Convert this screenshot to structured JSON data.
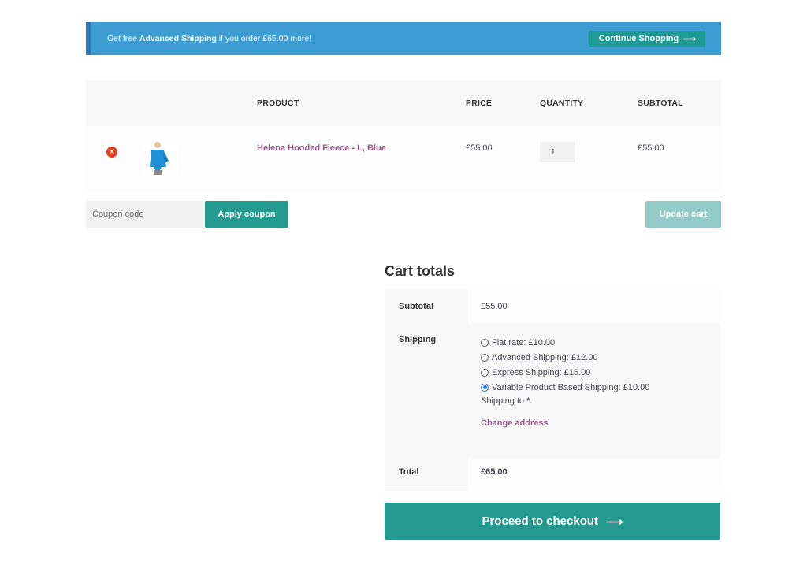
{
  "notice": {
    "prefix": "Get free ",
    "highlight": "Advanced Shipping",
    "suffix": " if you order £65.00 more!",
    "button_label": "Continue Shopping",
    "button_icon": "arrow-right-icon"
  },
  "cart": {
    "columns": [
      "",
      "",
      "PRODUCT",
      "PRICE",
      "QUANTITY",
      "SUBTOTAL"
    ],
    "items": [
      {
        "remove_icon": "remove-x-icon",
        "image": "blue-hooded-fleece",
        "name": "Helena Hooded Fleece - L, Blue",
        "price": "£55.00",
        "quantity": "1",
        "subtotal": "£55.00"
      }
    ]
  },
  "actions": {
    "coupon_placeholder": "Coupon code",
    "apply_coupon": "Apply coupon",
    "update_cart": "Update cart"
  },
  "totals": {
    "title": "Cart totals",
    "subtotal_label": "Subtotal",
    "subtotal_value": "£55.00",
    "shipping_label": "Shipping",
    "shipping_options": [
      {
        "label": "Flat rate: £10.00",
        "selected": false
      },
      {
        "label": "Advanced Shipping: £12.00",
        "selected": false
      },
      {
        "label": "Express Shipping: £15.00",
        "selected": false
      },
      {
        "label": "Variable Product Based Shipping: £10.00",
        "selected": true
      }
    ],
    "shipping_to_prefix": "Shipping to ",
    "shipping_to_dest": "*",
    "shipping_to_suffix": ".",
    "change_address": "Change address",
    "total_label": "Total",
    "total_value": "£65.00",
    "checkout_label": "Proceed to checkout"
  },
  "colors": {
    "notice_bg": "#3d9cd2",
    "primary": "#24998f",
    "disabled": "#92cbc7",
    "link": "#96588a",
    "remove": "#e2401c"
  }
}
